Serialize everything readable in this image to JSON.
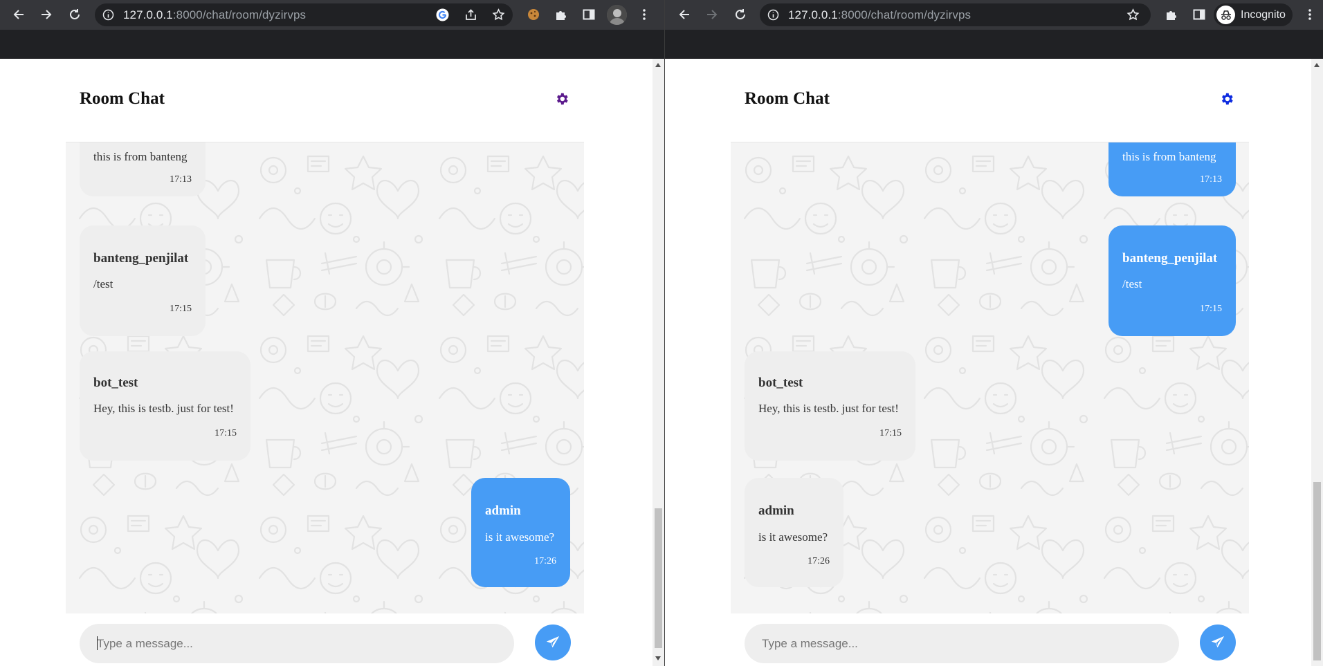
{
  "browser": {
    "url_host": "127.0.0.1",
    "url_path": ":8000/chat/room/dyzirvps",
    "incognito_label": "Incognito"
  },
  "chat": {
    "title": "Room Chat",
    "input_placeholder": "Type a message...",
    "messages": [
      {
        "sender": "",
        "text": "this is from banteng",
        "time": "17:13"
      },
      {
        "sender": "banteng_penjilat",
        "text": "/test",
        "time": "17:15"
      },
      {
        "sender": "bot_test",
        "text": "Hey, this is testb. just for test!",
        "time": "17:15"
      },
      {
        "sender": "admin",
        "text": "is it awesome?",
        "time": "17:26"
      }
    ]
  },
  "views": {
    "left": {
      "current_user": "admin",
      "theme_color": "#5b1a8c"
    },
    "right": {
      "current_user": "banteng_penjilat",
      "theme_color": "#0d2be0"
    }
  },
  "colors": {
    "sent_bubble": "#479cf5",
    "received_bubble": "#eeeeee",
    "browser_toolbar": "#35363a",
    "browser_frame": "#202124"
  },
  "icons": {
    "back": "arrow-left-icon",
    "forward": "arrow-right-icon",
    "reload": "reload-icon",
    "site_info": "info-icon",
    "google": "google-icon",
    "share": "share-icon",
    "bookmark": "star-icon",
    "cookie": "cookie-icon",
    "extensions": "puzzle-icon",
    "side_panel": "side-panel-icon",
    "profile": "avatar",
    "menu": "kebab-menu-icon",
    "settings": "gear-icon",
    "send": "paper-plane-icon",
    "incognito": "incognito-icon"
  }
}
